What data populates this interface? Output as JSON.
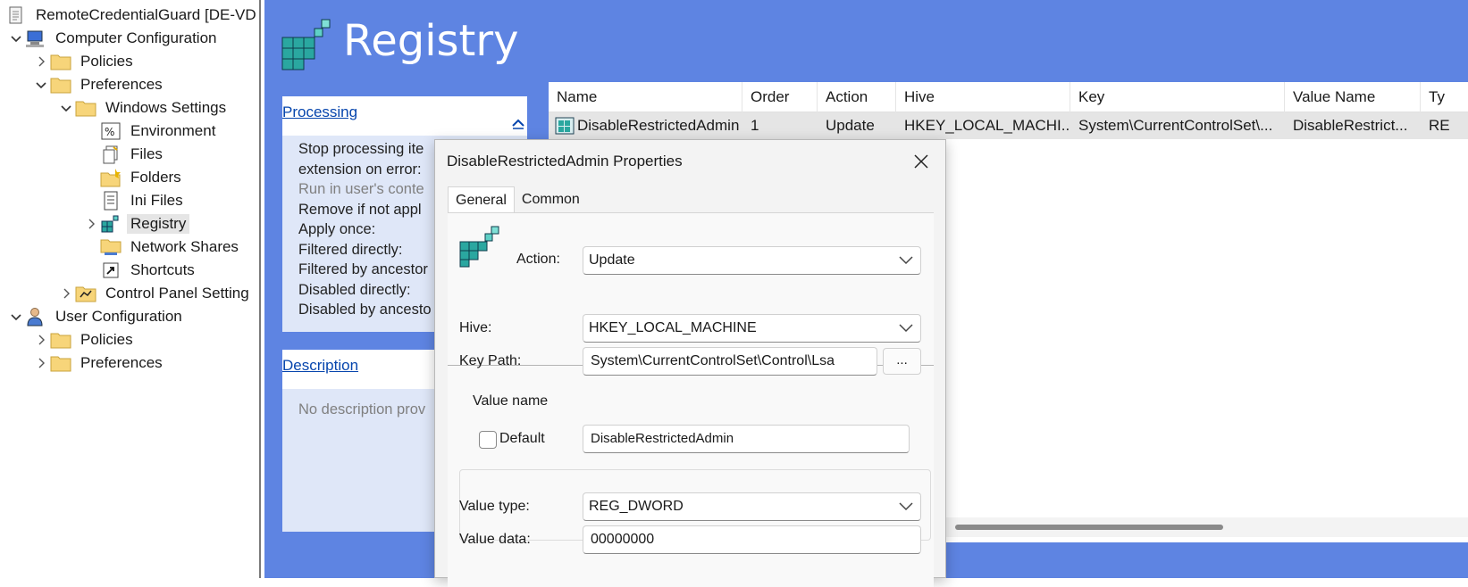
{
  "tree": {
    "root": "RemoteCredentialGuard [DE-VD",
    "computer_config": "Computer Configuration",
    "policies": "Policies",
    "preferences": "Preferences",
    "windows_settings": "Windows Settings",
    "environment": "Environment",
    "files": "Files",
    "folders": "Folders",
    "ini_files": "Ini Files",
    "registry": "Registry",
    "network_shares": "Network Shares",
    "shortcuts": "Shortcuts",
    "control_panel": "Control Panel Setting",
    "user_config": "User Configuration",
    "user_policies": "Policies",
    "user_preferences": "Preferences"
  },
  "detail": {
    "title": "Registry",
    "processing": {
      "link": "Processing",
      "lines": [
        "Stop processing ite",
        "extension on error:",
        "Run in user's conte",
        "Remove if not appl",
        "Apply once:",
        "Filtered directly:",
        "Filtered by ancestor",
        "Disabled directly:",
        "Disabled by ancesto"
      ]
    },
    "description": {
      "link": "Description",
      "text": "No description prov"
    }
  },
  "list": {
    "columns": [
      "Name",
      "Order",
      "Action",
      "Hive",
      "Key",
      "Value Name",
      "Ty"
    ],
    "row": {
      "name": "DisableRestrictedAdmin",
      "order": "1",
      "action": "Update",
      "hive": "HKEY_LOCAL_MACHI...",
      "key": "System\\CurrentControlSet\\...",
      "value_name": "DisableRestrict...",
      "type": "RE"
    }
  },
  "dialog": {
    "title": "DisableRestrictedAdmin Properties",
    "tabs": [
      "General",
      "Common"
    ],
    "action_label": "Action:",
    "action_value": "Update",
    "hive_label": "Hive:",
    "hive_value": "HKEY_LOCAL_MACHINE",
    "keypath_label": "Key Path:",
    "keypath_value": "System\\CurrentControlSet\\Control\\Lsa",
    "browse_label": "...",
    "value_name_group": "Value name",
    "default_label": "Default",
    "default_checked": false,
    "value_name": "DisableRestrictedAdmin",
    "value_type_label": "Value type:",
    "value_type": "REG_DWORD",
    "value_data_label": "Value data:",
    "value_data": "00000000"
  },
  "colors": {
    "pane_blue": "#5e84e2",
    "link_blue": "#0645ad",
    "section_bg": "#dfe7f8",
    "selected_row": "#e5e5e5"
  }
}
